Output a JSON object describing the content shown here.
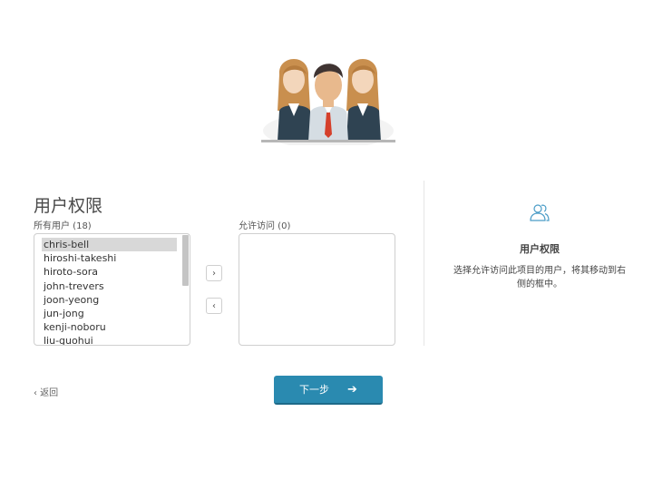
{
  "page": {
    "title": "用户权限"
  },
  "all_users": {
    "label": "所有用户 (18)",
    "items": [
      {
        "name": "chris-bell",
        "selected": true
      },
      {
        "name": "hiroshi-takeshi",
        "selected": false
      },
      {
        "name": "hiroto-sora",
        "selected": false
      },
      {
        "name": "john-trevers",
        "selected": false
      },
      {
        "name": "joon-yeong",
        "selected": false
      },
      {
        "name": "jun-jong",
        "selected": false
      },
      {
        "name": "kenji-noboru",
        "selected": false
      },
      {
        "name": "liu-guohui",
        "selected": false
      }
    ]
  },
  "allowed_users": {
    "label": "允许访问 (0)",
    "items": []
  },
  "controls": {
    "move_right_icon": "›",
    "move_left_icon": "‹"
  },
  "side_panel": {
    "icon": "users-icon",
    "title": "用户权限",
    "description": "选择允许访问此项目的用户，将其移动到右侧的框中。"
  },
  "footer": {
    "back_label": "‹ 返回",
    "next_label": "下一步",
    "next_arrow": "➔"
  },
  "colors": {
    "primary_button": "#2a8ab0",
    "selected_row": "#d8d8d8",
    "side_icon": "#4a9cc7"
  }
}
